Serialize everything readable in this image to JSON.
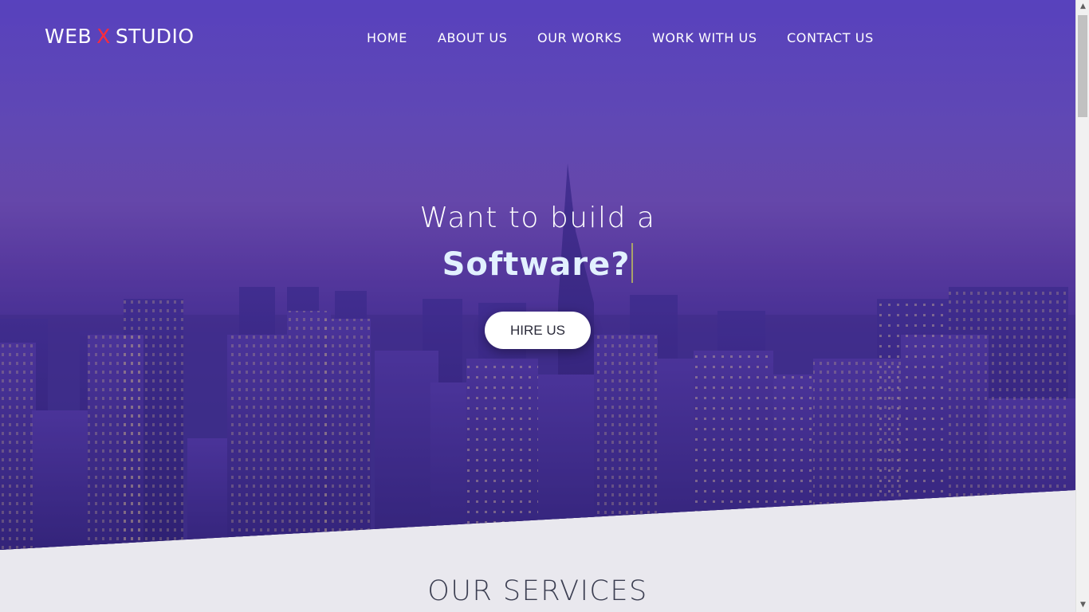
{
  "brand": {
    "part1": "WEB",
    "x": "X",
    "part2": "STUDIO",
    "x_color": "#ff2b3a"
  },
  "nav": {
    "items": [
      {
        "label": "HOME"
      },
      {
        "label": "ABOUT US"
      },
      {
        "label": "OUR WORKS"
      },
      {
        "label": "WORK WITH US"
      },
      {
        "label": "CONTACT US"
      }
    ]
  },
  "hero": {
    "line1": "Want to build a",
    "typed_word": "Software?",
    "button_label": "HIRE US",
    "gradient_colors": [
      "#5c48c2",
      "#6e4fa8",
      "#35307e"
    ]
  },
  "services": {
    "title": "OUR SERVICES"
  },
  "scrollbar": {
    "up_icon": "▲",
    "down_icon": "▼"
  }
}
